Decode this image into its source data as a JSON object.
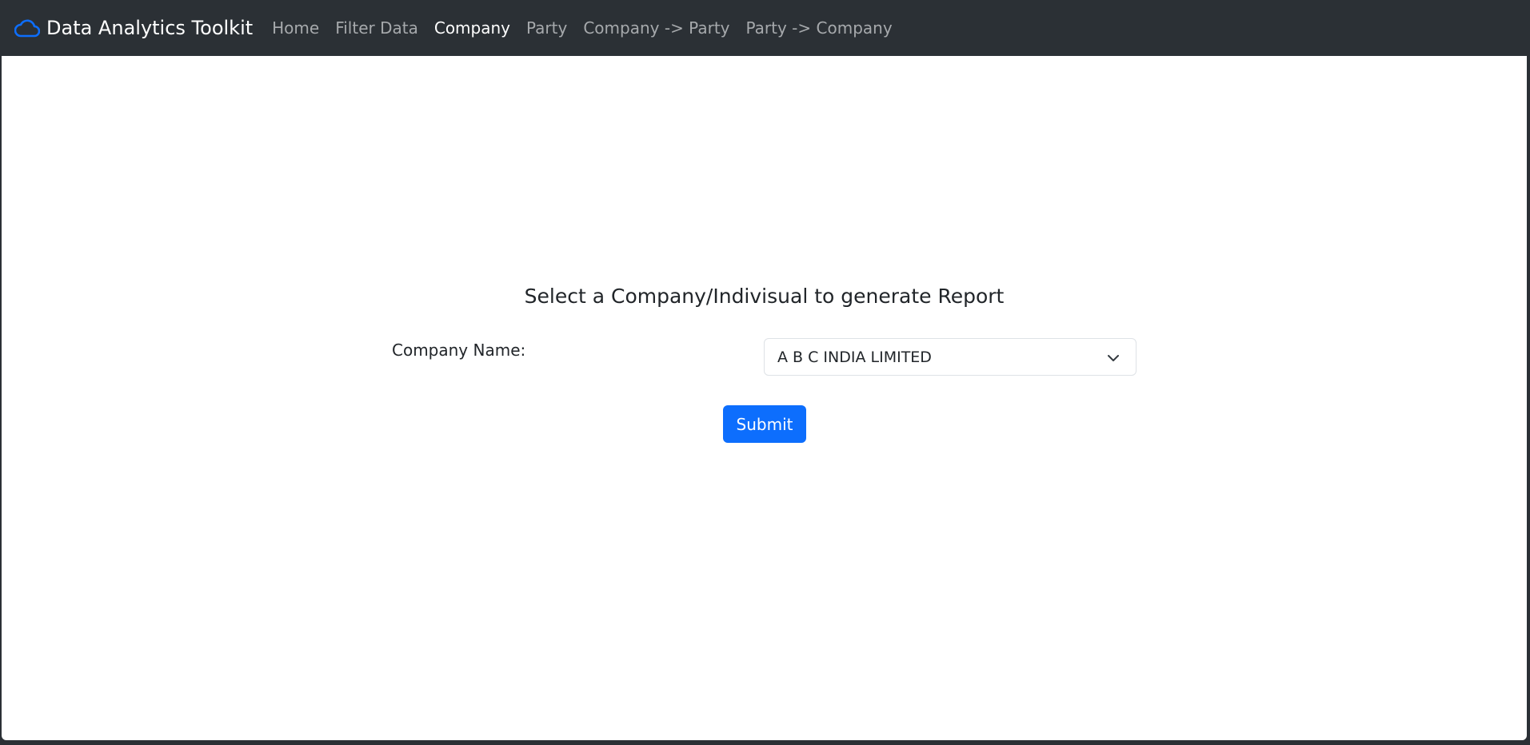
{
  "navbar": {
    "brand_label": "Data Analytics Toolkit",
    "brand_icon": "cloud-icon",
    "links": [
      {
        "label": "Home",
        "active": false
      },
      {
        "label": "Filter Data",
        "active": false
      },
      {
        "label": "Company",
        "active": true
      },
      {
        "label": "Party",
        "active": false
      },
      {
        "label": "Company -> Party",
        "active": false
      },
      {
        "label": "Party -> Company",
        "active": false
      }
    ]
  },
  "form": {
    "heading": "Select a Company/Indivisual to generate Report",
    "company_label": "Company Name:",
    "company_selected": "A B C INDIA LIMITED",
    "submit_label": "Submit"
  },
  "colors": {
    "navbar_bg": "#2b3035",
    "brand_icon": "#0d6efd",
    "primary": "#0d6efd"
  }
}
